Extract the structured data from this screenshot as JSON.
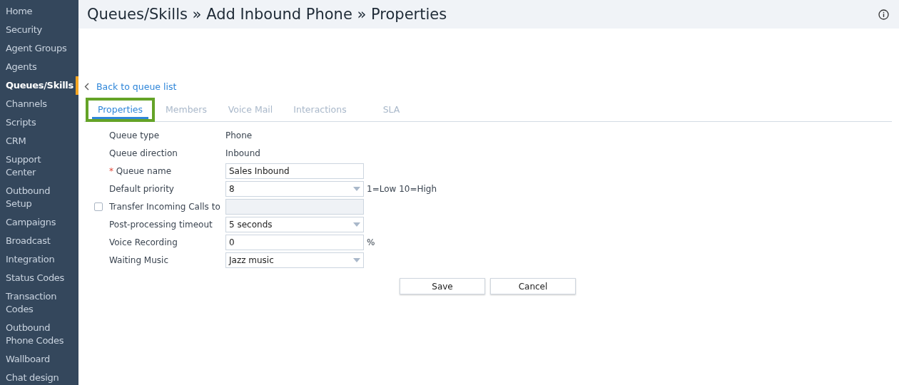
{
  "sidebar": {
    "items": [
      {
        "label": "Home",
        "selected": false
      },
      {
        "label": "Security",
        "selected": false
      },
      {
        "label": "Agent Groups",
        "selected": false
      },
      {
        "label": "Agents",
        "selected": false
      },
      {
        "label": "Queues/Skills",
        "selected": true
      },
      {
        "label": "Channels",
        "selected": false
      },
      {
        "label": "Scripts",
        "selected": false
      },
      {
        "label": "CRM",
        "selected": false
      },
      {
        "label": "Support Center",
        "selected": false
      },
      {
        "label": "Outbound Setup",
        "selected": false
      },
      {
        "label": "Campaigns",
        "selected": false
      },
      {
        "label": "Broadcast",
        "selected": false
      },
      {
        "label": "Integration",
        "selected": false
      },
      {
        "label": "Status Codes",
        "selected": false
      },
      {
        "label": "Transaction Codes",
        "selected": false
      },
      {
        "label": "Outbound Phone Codes",
        "selected": false
      },
      {
        "label": "Wallboard",
        "selected": false
      },
      {
        "label": "Chat design",
        "selected": false
      }
    ]
  },
  "header": {
    "title": "Queues/Skills » Add Inbound Phone » Properties"
  },
  "back_link": "Back to queue list",
  "tabs": [
    {
      "label": "Properties",
      "selected": true,
      "highlighted": true
    },
    {
      "label": "Members",
      "selected": false,
      "highlighted": false
    },
    {
      "label": "Voice Mail",
      "selected": false,
      "highlighted": false
    },
    {
      "label": "Interactions",
      "selected": false,
      "highlighted": false
    },
    {
      "label": "SLA",
      "selected": false,
      "highlighted": false
    }
  ],
  "form": [
    {
      "kind": "text",
      "label": "Queue type",
      "value": "Phone"
    },
    {
      "kind": "text",
      "label": "Queue direction",
      "value": "Inbound"
    },
    {
      "kind": "input",
      "label": "Queue name",
      "required_mark": "*",
      "value": "Sales Inbound"
    },
    {
      "kind": "select",
      "label": "Default priority",
      "value": "8",
      "suffix": "1=Low 10=High"
    },
    {
      "kind": "input",
      "label": "Transfer Incoming Calls to",
      "checked": false,
      "disabled": true
    },
    {
      "kind": "select",
      "label": "Post-processing timeout",
      "value": "5 seconds"
    },
    {
      "kind": "input",
      "label": "Voice Recording",
      "value": "0",
      "suffix": "%"
    },
    {
      "kind": "select",
      "label": "Waiting Music",
      "value": "Jazz music"
    }
  ],
  "buttons": [
    "Save",
    "Cancel"
  ]
}
